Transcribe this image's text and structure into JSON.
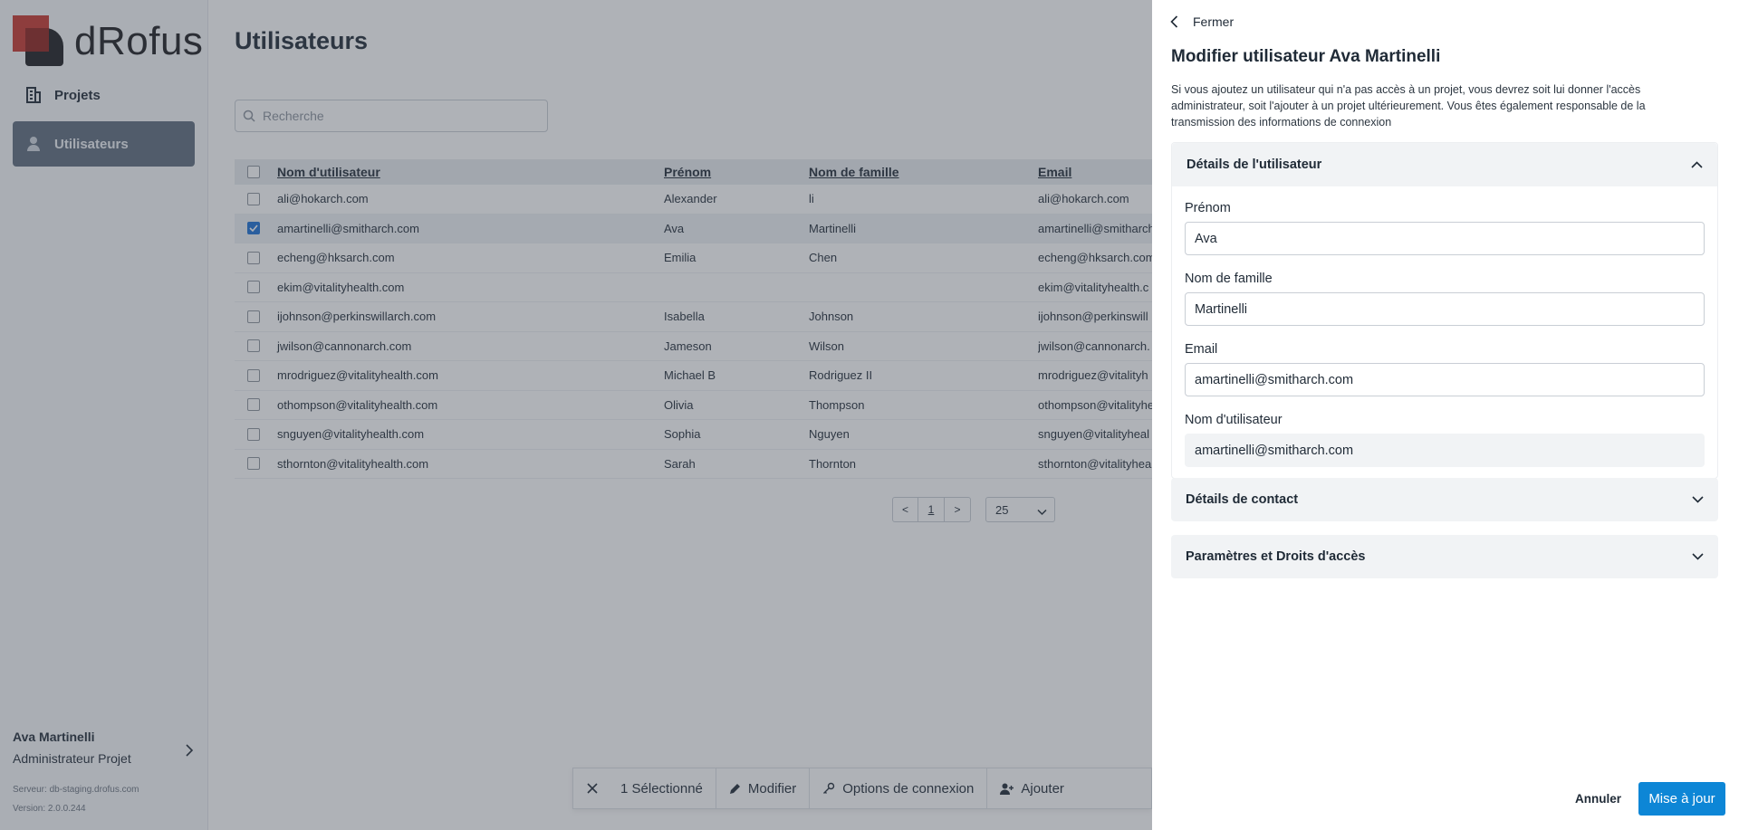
{
  "app": {
    "brand": "dRofus",
    "brand_color": "#c6362e"
  },
  "sidebar": {
    "items": [
      {
        "label": "Projets",
        "icon": "building-icon"
      },
      {
        "label": "Utilisateurs",
        "icon": "user-icon"
      }
    ],
    "user": {
      "name": "Ava Martinelli",
      "role": "Administrateur Projet"
    },
    "server": "Serveur: db-staging.drofus.com",
    "version": "Version: 2.0.0.244"
  },
  "main": {
    "title": "Utilisateurs",
    "search_placeholder": "Recherche",
    "columns": [
      "Nom d'utilisateur",
      "Prénom",
      "Nom de famille",
      "Email"
    ],
    "rows": [
      {
        "username": "ali@hokarch.com",
        "first": "Alexander",
        "last": "li",
        "email": "ali@hokarch.com",
        "selected": false
      },
      {
        "username": "amartinelli@smitharch.com",
        "first": "Ava",
        "last": "Martinelli",
        "email": "amartinelli@smitharch",
        "selected": true
      },
      {
        "username": "echeng@hksarch.com",
        "first": "Emilia",
        "last": "Chen",
        "email": "echeng@hksarch.com",
        "selected": false
      },
      {
        "username": "ekim@vitalityhealth.com",
        "first": "",
        "last": "",
        "email": "ekim@vitalityhealth.c",
        "selected": false
      },
      {
        "username": "ijohnson@perkinswillarch.com",
        "first": "Isabella",
        "last": "Johnson",
        "email": "ijohnson@perkinswill",
        "selected": false
      },
      {
        "username": "jwilson@cannonarch.com",
        "first": "Jameson",
        "last": "Wilson",
        "email": "jwilson@cannonarch.",
        "selected": false
      },
      {
        "username": "mrodriguez@vitalityhealth.com",
        "first": "Michael B",
        "last": "Rodriguez II",
        "email": "mrodriguez@vitalityh",
        "selected": false
      },
      {
        "username": "othompson@vitalityhealth.com",
        "first": "Olivia",
        "last": "Thompson",
        "email": "othompson@vitalityhe",
        "selected": false
      },
      {
        "username": "snguyen@vitalityhealth.com",
        "first": "Sophia",
        "last": "Nguyen",
        "email": "snguyen@vitalityheal",
        "selected": false
      },
      {
        "username": "sthornton@vitalityhealth.com",
        "first": "Sarah",
        "last": "Thornton",
        "email": "sthornton@vitalityhea",
        "selected": false
      }
    ],
    "pager": {
      "prev": "<",
      "page": "1",
      "next": ">",
      "page_size": "25"
    },
    "actionbar": {
      "selected": "1 Sélectionné",
      "edit": "Modifier",
      "login_options": "Options de connexion",
      "add": "Ajouter"
    }
  },
  "drawer": {
    "close": "Fermer",
    "title": "Modifier utilisateur Ava Martinelli",
    "description": "Si vous ajoutez un utilisateur qui n'a pas accès à un projet, vous devrez soit lui donner l'accès administrateur, soit l'ajouter à un projet ultérieurement. Vous êtes également responsable de la transmission des informations de connexion",
    "user_details": {
      "title": "Détails de l'utilisateur",
      "first_label": "Prénom",
      "first_value": "Ava",
      "last_label": "Nom de famille",
      "last_value": "Martinelli",
      "email_label": "Email",
      "email_value": "amartinelli@smitharch.com",
      "username_label": "Nom d'utilisateur",
      "username_value": "amartinelli@smitharch.com"
    },
    "contact_title": "Détails de contact",
    "params_title": "Paramètres et Droits d'accès",
    "cancel": "Annuler",
    "update": "Mise à jour",
    "primary_color": "#0d86d6"
  }
}
